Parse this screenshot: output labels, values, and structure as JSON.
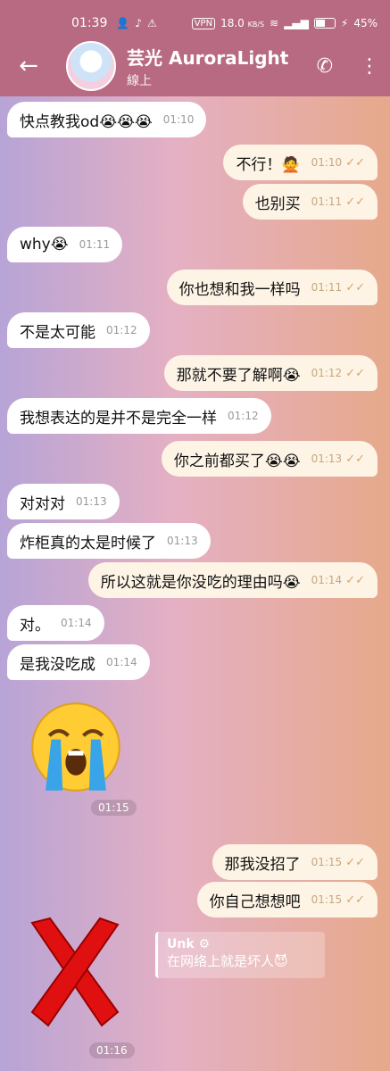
{
  "status": {
    "time": "01:39",
    "vpn": "VPN",
    "net_speed": "18.0",
    "net_unit": "KB/S",
    "battery": "45%"
  },
  "header": {
    "title": "芸光 AuroraLight",
    "subtitle": "線上"
  },
  "messages": [
    {
      "text": "快点教我od😭😭😭",
      "time": "01:10"
    },
    {
      "text": "不行！🙅",
      "time": "01:10"
    },
    {
      "text": "也别买",
      "time": "01:11"
    },
    {
      "text": "why😭",
      "time": "01:11"
    },
    {
      "text": "你也想和我一样吗",
      "time": "01:11"
    },
    {
      "text": "不是太可能",
      "time": "01:12"
    },
    {
      "text": "那就不要了解啊😭",
      "time": "01:12"
    },
    {
      "text": "我想表达的是并不是完全一样",
      "time": "01:12"
    },
    {
      "text": "你之前都买了😭😭",
      "time": "01:13"
    },
    {
      "text": "对对对",
      "time": "01:13"
    },
    {
      "text": "炸柜真的太是时候了",
      "time": "01:13"
    },
    {
      "text": "所以这就是你没吃的理由吗😭",
      "time": "01:14"
    },
    {
      "text": "对。",
      "time": "01:14"
    },
    {
      "text": "是我没吃成",
      "time": "01:14"
    },
    {
      "text": "那我没招了",
      "time": "01:15"
    },
    {
      "text": "你自己想想吧",
      "time": "01:15"
    }
  ],
  "stickers": {
    "cry_time": "01:15",
    "x_time": "01:16"
  },
  "reply_card": {
    "name": "Unk",
    "text": "在网络上就是坏人😈"
  }
}
